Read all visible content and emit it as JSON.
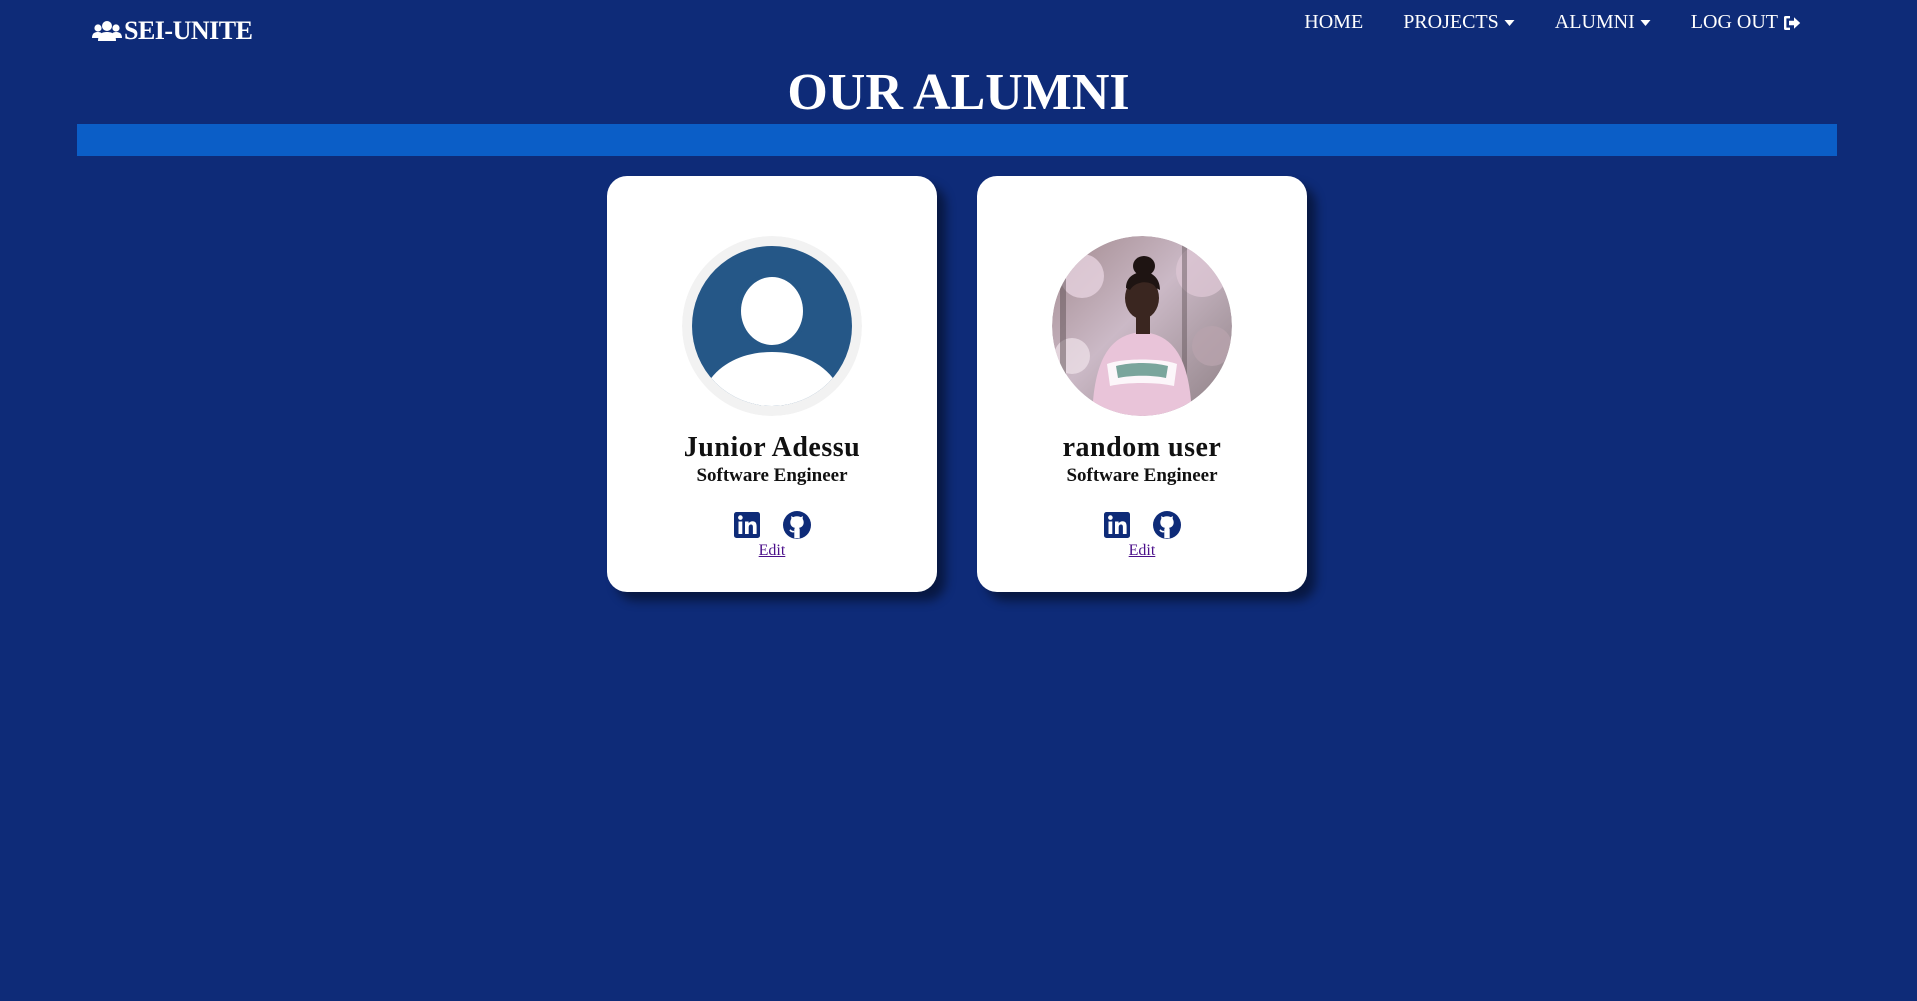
{
  "brand": {
    "name": "SEI-UNITE",
    "icon": "users-icon"
  },
  "nav": {
    "home": "HOME",
    "projects": "PROJECTS",
    "alumni": "ALUMNI",
    "logout": "LOG OUT"
  },
  "page": {
    "title": "OUR ALUMNI"
  },
  "colors": {
    "background": "#0e2b78",
    "title_bar": "#0b5ec7",
    "card": "#ffffff",
    "icon": "#0e2b78",
    "edit_link": "#4b0f8a"
  },
  "alumni": [
    {
      "name": "Junior Adessu",
      "role": "Software Engineer",
      "avatar": "default-avatar",
      "edit_label": "Edit",
      "socials": [
        "linkedin-icon",
        "github-icon"
      ]
    },
    {
      "name": "random user",
      "role": "Software Engineer",
      "avatar": "photo-avatar",
      "edit_label": "Edit",
      "socials": [
        "linkedin-icon",
        "github-icon"
      ]
    }
  ]
}
